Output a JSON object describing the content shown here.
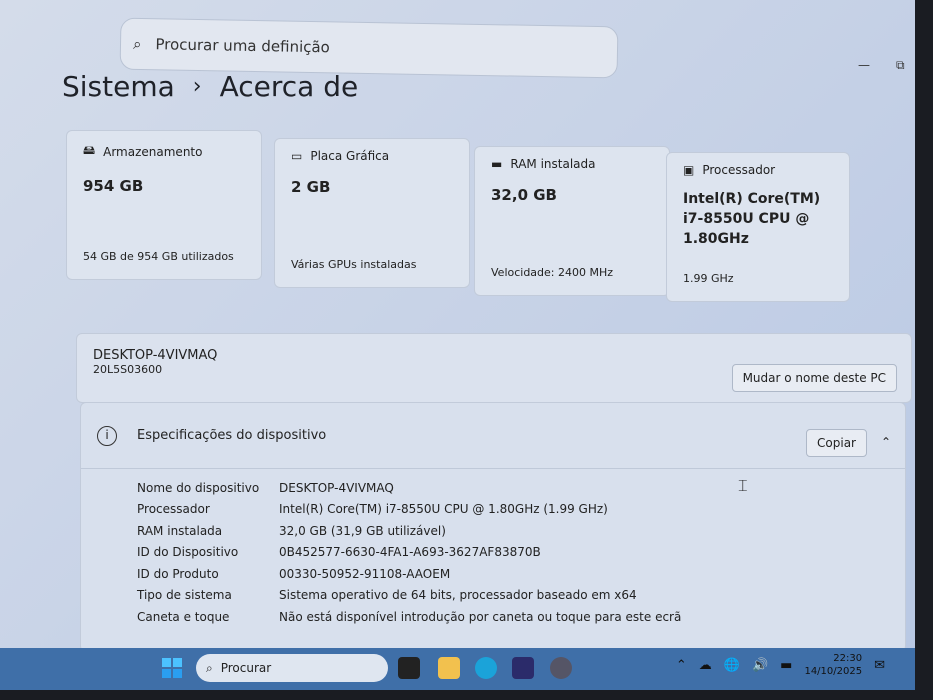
{
  "search": {
    "placeholder": "Procurar uma definição"
  },
  "breadcrumb": {
    "parent": "Sistema",
    "separator": "›",
    "current": "Acerca de"
  },
  "cards": [
    {
      "label": "Armazenamento",
      "value": "954 GB",
      "sub": "54 GB de 954 GB utilizados",
      "icon": "storage-icon"
    },
    {
      "label": "Placa Gráfica",
      "value": "2 GB",
      "sub": "Várias GPUs instaladas",
      "icon": "gpu-icon"
    },
    {
      "label": "RAM instalada",
      "value": "32,0 GB",
      "sub": "Velocidade: 2400 MHz",
      "icon": "ram-icon"
    },
    {
      "label": "Processador",
      "value": "Intel(R) Core(TM) i7-8550U CPU @ 1.80GHz",
      "sub": "1.99 GHz",
      "icon": "cpu-icon"
    }
  ],
  "pc": {
    "name": "DESKTOP-4VIVMAQ",
    "model": "20L5S03600",
    "rename_label": "Mudar o nome deste PC"
  },
  "specs": {
    "title": "Especificações do dispositivo",
    "copy_label": "Copiar",
    "rows": [
      {
        "k": "Nome do dispositivo",
        "v": "DESKTOP-4VIVMAQ"
      },
      {
        "k": "Processador",
        "v": "Intel(R) Core(TM) i7-8550U CPU @ 1.80GHz (1.99 GHz)"
      },
      {
        "k": "RAM instalada",
        "v": "32,0 GB (31,9 GB utilizável)"
      },
      {
        "k": "ID do Dispositivo",
        "v": "0B452577-6630-4FA1-A693-3627AF83870B"
      },
      {
        "k": "ID do Produto",
        "v": "00330-50952-91108-AAOEM"
      },
      {
        "k": "Tipo de sistema",
        "v": "Sistema operativo de 64 bits, processador baseado em x64"
      },
      {
        "k": "Caneta e toque",
        "v": "Não está disponível introdução por caneta ou toque para este ecrã"
      }
    ]
  },
  "taskbar": {
    "search_label": "Procurar",
    "time": "22:30",
    "date": "14/10/2025"
  }
}
